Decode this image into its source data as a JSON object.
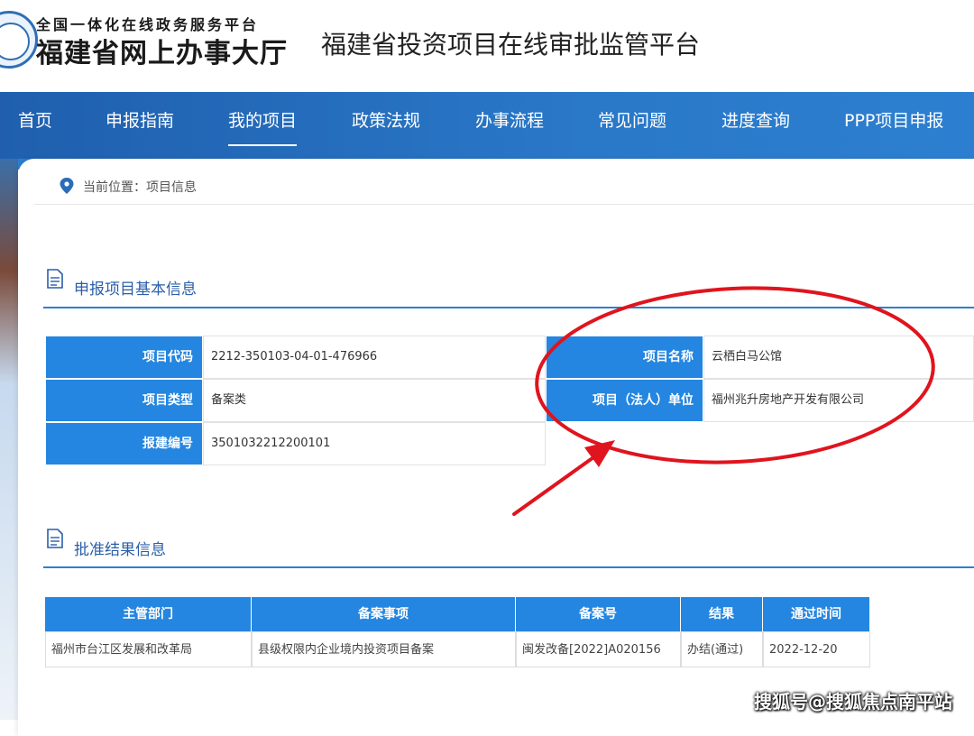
{
  "header": {
    "logo_top": "全国一体化在线政务服务平台",
    "logo_main": "福建省网上办事大厅",
    "platform_title": "福建省投资项目在线审批监管平台"
  },
  "nav": {
    "items": [
      {
        "label": "首页"
      },
      {
        "label": "申报指南"
      },
      {
        "label": "我的项目"
      },
      {
        "label": "政策法规"
      },
      {
        "label": "办事流程"
      },
      {
        "label": "常见问题"
      },
      {
        "label": "进度查询"
      },
      {
        "label": "PPP项目申报"
      }
    ],
    "active": "我的项目"
  },
  "breadcrumb": {
    "text": "当前位置：项目信息",
    "icon": "location-pin-icon"
  },
  "basic_info": {
    "title": "申报项目基本信息",
    "rows": [
      {
        "label": "项目代码",
        "value": "2212-350103-04-01-476966"
      },
      {
        "label": "项目类型",
        "value": "备案类"
      },
      {
        "label": "报建编号",
        "value": "3501032212200101"
      }
    ],
    "right_rows": [
      {
        "label": "项目名称",
        "value": "云栖白马公馆"
      },
      {
        "label": "项目（法人）单位",
        "value": "福州兆升房地产开发有限公司"
      }
    ]
  },
  "approval": {
    "title": "批准结果信息",
    "columns": [
      "主管部门",
      "备案事项",
      "备案号",
      "结果",
      "通过时间"
    ],
    "rows": [
      [
        "福州市台江区发展和改革局",
        "县级权限内企业境内投资项目备案",
        "闽发改备[2022]A020156",
        "办结(通过)",
        "2022-12-20"
      ]
    ]
  },
  "watermark": "搜狐号@搜狐焦点南平站",
  "colors": {
    "nav_bg": "#2a78c8",
    "table_header": "#2486e0",
    "annotation_red": "#e0141e",
    "section_title": "#2a5ea8"
  }
}
